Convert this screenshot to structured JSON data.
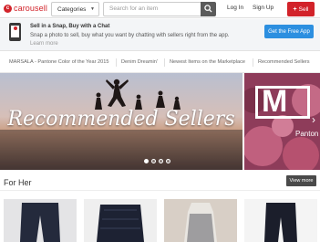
{
  "header": {
    "logo_text": "carousell",
    "logo_mark": "c",
    "categories_label": "Categories",
    "search_placeholder": "Search for an item",
    "login_label": "Log In",
    "signup_label": "Sign Up",
    "sell_label": "Sell",
    "sell_icon": "+"
  },
  "promo": {
    "title": "Sell in a Snap, Buy with a Chat",
    "description": "Snap a photo to sell, buy what you want by chatting with sellers right from the app.",
    "learn_more": "Learn more",
    "app_button": "Get the Free App"
  },
  "tabs": [
    {
      "label": "MARSALA - Pantone Color of the Year 2015"
    },
    {
      "label": "Denim Dreamin'"
    },
    {
      "label": "Newest Items on the Marketplace"
    },
    {
      "label": "Recommended Sellers"
    }
  ],
  "hero": {
    "title": "Recommended Sellers",
    "next_letter": "M",
    "next_caption": "Panton",
    "active_dot": 0,
    "dot_count": 4
  },
  "section": {
    "title": "For Her",
    "view_more": "View more"
  },
  "colors": {
    "brand": "#d2232a",
    "app_button": "#2c8fe0"
  }
}
